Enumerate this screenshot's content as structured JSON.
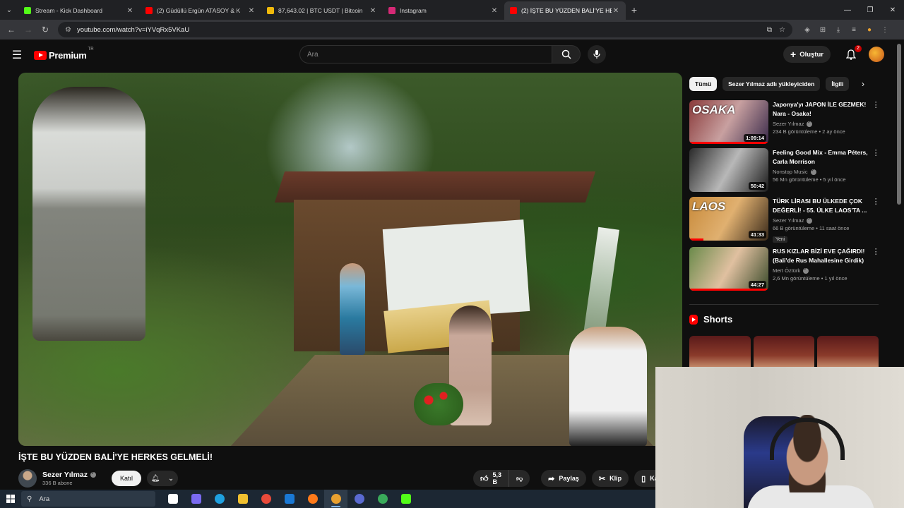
{
  "browser": {
    "tabs": [
      {
        "title": "Stream - Kick Dashboard",
        "favicon_color": "#53fc18",
        "active": false
      },
      {
        "title": "(2) Güdüllü Ergün ATASOY & K",
        "favicon_color": "#ff0000",
        "active": false
      },
      {
        "title": "87,643.02 | BTC USDT | Bitcoin",
        "favicon_color": "#f0b90b",
        "active": false
      },
      {
        "title": "Instagram",
        "favicon_color": "#d62976",
        "active": false
      },
      {
        "title": "(2) İŞTE BU YÜZDEN BALİ'YE HE",
        "favicon_color": "#ff0000",
        "active": true
      }
    ],
    "url": "youtube.com/watch?v=iYVqRx5VKaU"
  },
  "youtube": {
    "logo_text": "Premium",
    "logo_superscript": "TR",
    "search_placeholder": "Ara",
    "create_label": "Oluştur",
    "notification_count": "2"
  },
  "video": {
    "title": "İŞTE BU YÜZDEN BALİ'YE HERKES GELMELİ!",
    "channel_name": "Sezer Yılmaz",
    "subscribers": "336 B abone",
    "join_label": "Katıl",
    "likes": "5,3 B",
    "share_label": "Paylaş",
    "clip_label": "Klip",
    "save_label": "Kaydet"
  },
  "sidebar": {
    "chips": [
      "Tümü",
      "Sezer Yılmaz adlı yükleyiciden",
      "İlgili"
    ],
    "recommendations": [
      {
        "title": "Japonya'yı JAPON İLE GEZMEK! Nara - Osaka!",
        "channel": "Sezer Yılmaz",
        "verified": true,
        "stats": "234 B görüntüleme • 2 ay önce",
        "duration": "1:09:14",
        "overlay": "OSAKA",
        "thumb_colors": [
          "#8a3a3a",
          "#c8a0a0",
          "#3a2a4a"
        ],
        "badge": "",
        "watched": 1.0
      },
      {
        "title": "Feeling Good Mix - Emma Péters, Carla Morrison",
        "channel": "Nonstop Music",
        "verified": true,
        "stats": "56 Mn görüntüleme • 5 yıl önce",
        "duration": "50:42",
        "overlay": "",
        "thumb_colors": [
          "#2a2a2a",
          "#b8b8b8",
          "#1a1a1a"
        ],
        "badge": "",
        "watched": 0
      },
      {
        "title": "TÜRK LİRASI BU ÜLKEDE ÇOK DEĞERLİ! - 55. ÜLKE LAOS'TA ...",
        "channel": "Sezer Yılmaz",
        "verified": true,
        "stats": "66 B görüntüleme • 11 saat önce",
        "duration": "41:33",
        "overlay": "LAOS",
        "thumb_colors": [
          "#c88a3a",
          "#e0b070",
          "#3a2a1a"
        ],
        "badge": "Yeni",
        "watched": 0.18
      },
      {
        "title": "RUS KIZLAR BİZİ EVE ÇAĞIRDI! (Bali'de Rus Mahallesine Girdik)",
        "channel": "Mert Öztürk",
        "verified": true,
        "stats": "2,6 Mn görüntüleme • 1 yıl önce",
        "duration": "44:27",
        "overlay": "",
        "thumb_colors": [
          "#6a8a4a",
          "#e0c0a0",
          "#3a4a2a"
        ],
        "badge": "",
        "watched": 1.0
      }
    ],
    "shorts_title": "Shorts"
  },
  "taskbar": {
    "search_placeholder": "Ara",
    "apps": [
      {
        "name": "task-view",
        "color": "#ffffff",
        "active": false
      },
      {
        "name": "copilot",
        "color": "#7a6af0",
        "active": false
      },
      {
        "name": "edge",
        "color": "#1fa0e0",
        "active": false
      },
      {
        "name": "file-explorer",
        "color": "#f0c030",
        "active": false
      },
      {
        "name": "chrome",
        "color": "#e84a3a",
        "active": false
      },
      {
        "name": "outlook",
        "color": "#1a78d4",
        "active": false
      },
      {
        "name": "firefox",
        "color": "#ff7a1a",
        "active": false
      },
      {
        "name": "chrome-profile",
        "color": "#e8a030",
        "active": true
      },
      {
        "name": "obs",
        "color": "#5a6ad0",
        "active": false
      },
      {
        "name": "chrome-alt",
        "color": "#3aaa5a",
        "active": false
      },
      {
        "name": "kick",
        "color": "#53fc18",
        "active": false
      }
    ]
  }
}
